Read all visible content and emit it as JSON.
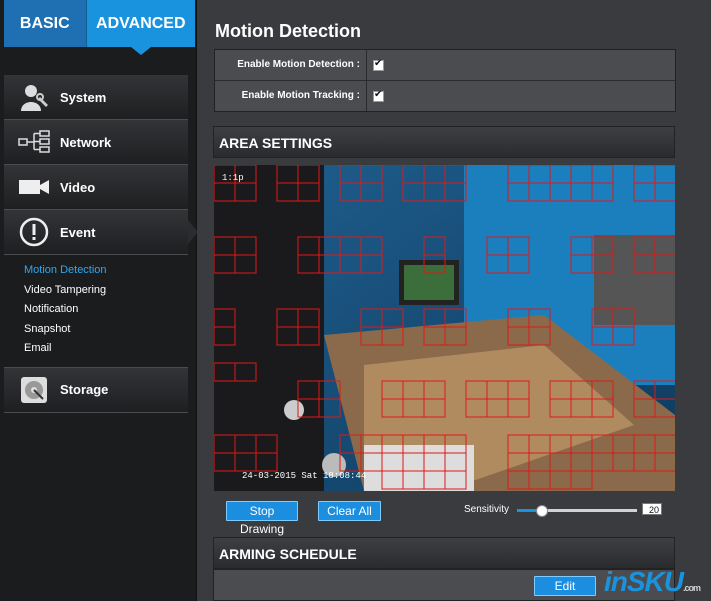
{
  "tabs": {
    "basic": "BASIC",
    "advanced": "ADVANCED"
  },
  "nav": {
    "system": "System",
    "network": "Network",
    "video": "Video",
    "event": "Event",
    "event_sub": [
      "Motion Detection",
      "Video Tampering",
      "Notification",
      "Snapshot",
      "Email"
    ],
    "storage": "Storage"
  },
  "page": {
    "title": "Motion Detection",
    "enable_motion_detection": "Enable Motion Detection :",
    "enable_motion_tracking": "Enable Motion Tracking :",
    "motion_detection_checked": true,
    "motion_tracking_checked": true
  },
  "area": {
    "header": "AREA SETTINGS",
    "camera_label": "1:1p",
    "timestamp": "24-03-2015 Sat 18:08:44",
    "stop_drawing": "Stop Drawing",
    "clear_all": "Clear All",
    "sensitivity_label": "Sensitivity",
    "sensitivity_value": "20",
    "sensitivity_fraction": 0.2
  },
  "arming": {
    "header": "ARMING SCHEDULE",
    "edit": "Edit"
  },
  "watermark": {
    "main": "inSKU",
    "sub": ".com"
  },
  "colors": {
    "accent": "#1a93df",
    "grid": "#e01818"
  }
}
